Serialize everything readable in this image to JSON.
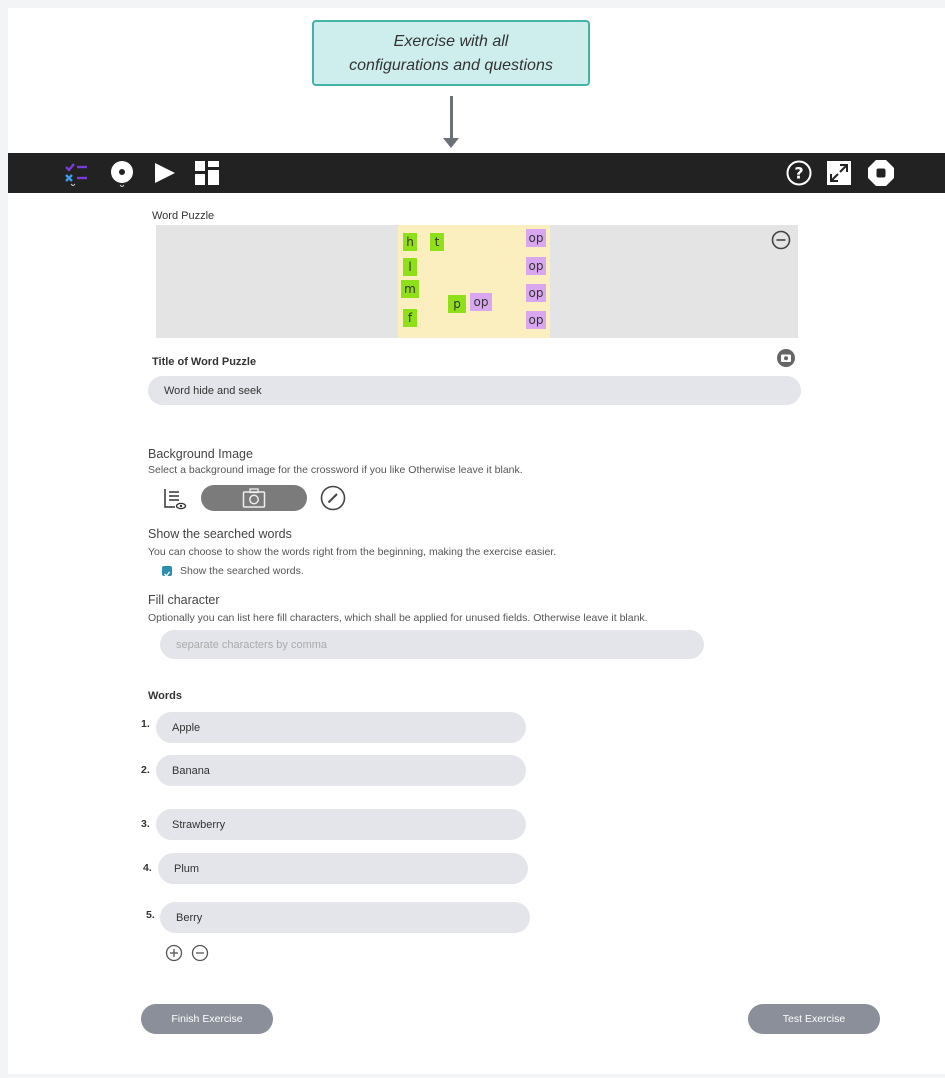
{
  "callout": {
    "line1": "Exercise with all",
    "line2": "configurations and questions"
  },
  "toolbar": {
    "left_icons": [
      "checklist-icon",
      "disc-icon",
      "play-icon",
      "grid-icon"
    ],
    "right_icons": [
      "help-icon",
      "expand-icon",
      "stop-icon"
    ]
  },
  "puzzle": {
    "label": "Word Puzzle",
    "cells": [
      {
        "char": "h",
        "color": "green"
      },
      {
        "char": "t",
        "color": "green"
      },
      {
        "char": "op",
        "color": "purple"
      },
      {
        "char": "l",
        "color": "green"
      },
      {
        "char": "op",
        "color": "purple"
      },
      {
        "char": "m",
        "color": "green"
      },
      {
        "char": "p",
        "color": "green"
      },
      {
        "char": "op",
        "color": "purple"
      },
      {
        "char": "op",
        "color": "purple"
      },
      {
        "char": "f",
        "color": "green"
      },
      {
        "char": "op",
        "color": "purple"
      }
    ]
  },
  "title_section": {
    "label": "Title of Word Puzzle",
    "value": "Word hide and seek"
  },
  "background": {
    "label": "Background Image",
    "description": "Select a background image for the crossword if you like Otherwise leave it blank."
  },
  "searched": {
    "label": "Show the searched words",
    "description": "You can choose to show the words right from the beginning, making the exercise easier.",
    "checkbox_label": "Show the searched words.",
    "checked": true
  },
  "fill": {
    "label": "Fill character",
    "description": "Optionally you can list here fill characters, which shall be applied for unused fields. Otherwise leave it blank.",
    "placeholder": "separate characters by comma"
  },
  "words": {
    "label": "Words",
    "items": [
      {
        "num": "1.",
        "value": "Apple"
      },
      {
        "num": "2.",
        "value": "Banana"
      },
      {
        "num": "3.",
        "value": "Strawberry"
      },
      {
        "num": "4.",
        "value": "Plum"
      },
      {
        "num": "5.",
        "value": "Berry"
      }
    ]
  },
  "buttons": {
    "finish": "Finish Exercise",
    "test": "Test Exercise"
  },
  "colors": {
    "callout_bg": "#cdeeed",
    "callout_border": "#43b3a8",
    "toolbar": "#222222",
    "cell_green": "#8fe01a",
    "cell_purple": "#d9a7ef",
    "checkbox": "#2d8fb0"
  }
}
